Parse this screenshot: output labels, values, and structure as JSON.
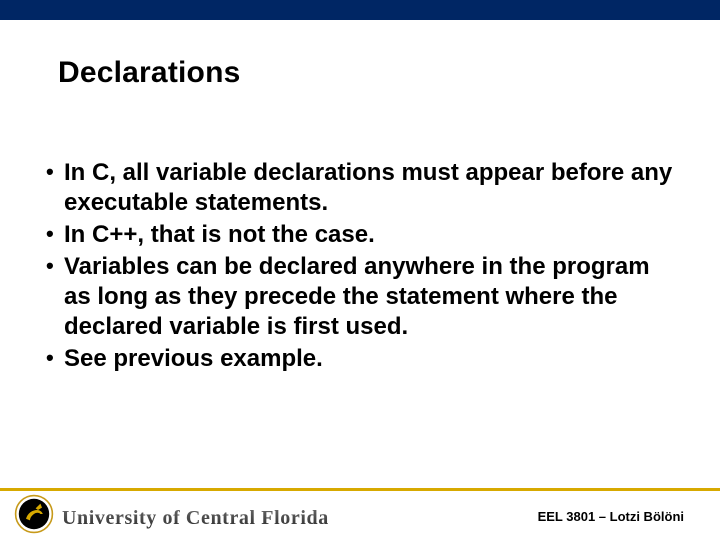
{
  "slide": {
    "title": "Declarations",
    "bullets": [
      "In C, all variable declarations must appear before any executable statements.",
      "In C++, that is not the case.",
      "Variables can be declared anywhere in the program as long as they precede the statement where the declared variable is first used.",
      "See previous example."
    ]
  },
  "footer": {
    "university": "University of Central Florida",
    "course": "EEL 3801 – Lotzi Bölöni"
  }
}
